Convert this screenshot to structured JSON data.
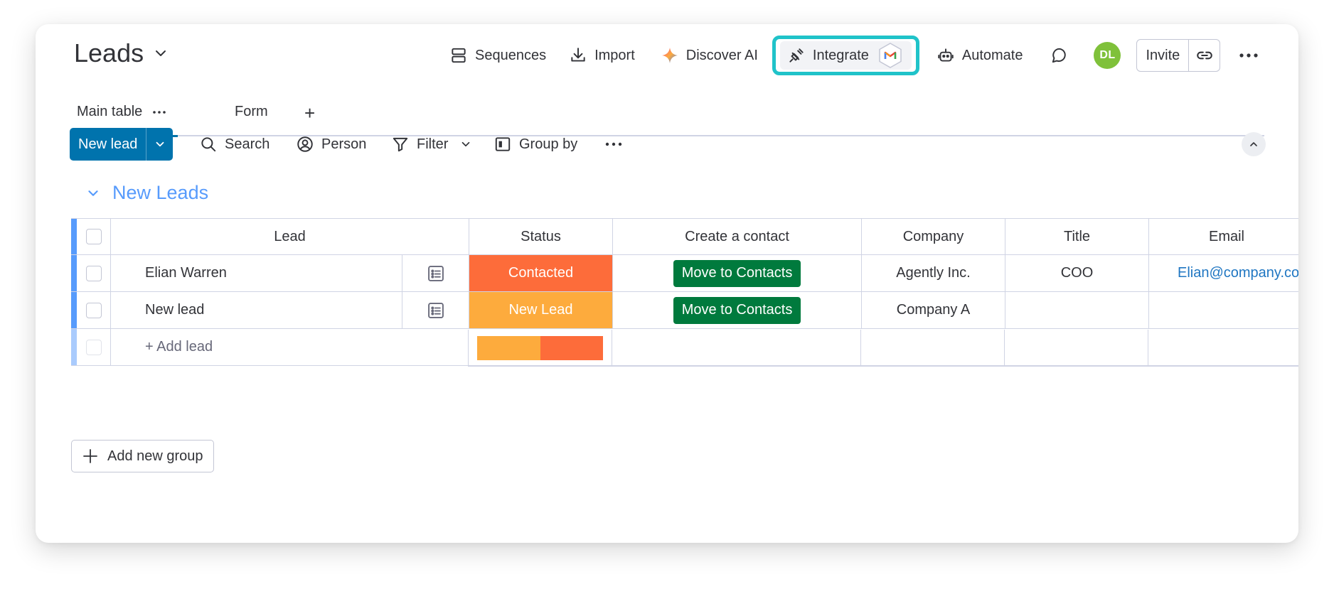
{
  "board": {
    "title": "Leads"
  },
  "top_actions": {
    "sequences": "Sequences",
    "import": "Import",
    "discover_ai": "Discover AI",
    "integrate": "Integrate",
    "automate": "Automate",
    "avatar_initials": "DL",
    "invite": "Invite"
  },
  "tabs": {
    "main": "Main table",
    "form": "Form",
    "add": "+"
  },
  "toolbar": {
    "new_item": "New lead",
    "search": "Search",
    "person": "Person",
    "filter": "Filter",
    "group_by": "Group by"
  },
  "group": {
    "title": "New Leads",
    "columns": {
      "lead": "Lead",
      "status": "Status",
      "create_contact": "Create a contact",
      "company": "Company",
      "title": "Title",
      "email": "Email"
    },
    "rows": [
      {
        "lead": "Elian Warren",
        "status": "Contacted",
        "status_color": "#fd6c3a",
        "action": "Move to Contacts",
        "company": "Agently Inc.",
        "title": "COO",
        "email": "Elian@company.com"
      },
      {
        "lead": "New lead",
        "status": "New Lead",
        "status_color": "#fdab3d",
        "action": "Move to Contacts",
        "company": "Company A",
        "title": "",
        "email": ""
      }
    ],
    "add_item": "+ Add lead",
    "status_summary": [
      {
        "label": "New Lead",
        "color": "#fdab3d",
        "fraction": 0.5
      },
      {
        "label": "Contacted",
        "color": "#fd6c3a",
        "fraction": 0.5
      }
    ]
  },
  "add_group": "Add new group",
  "colors": {
    "primary": "#0073ad",
    "group_accent": "#579bfc",
    "highlight": "#20c3c9",
    "action_green": "#007a3d",
    "avatar": "#7fc13a"
  }
}
